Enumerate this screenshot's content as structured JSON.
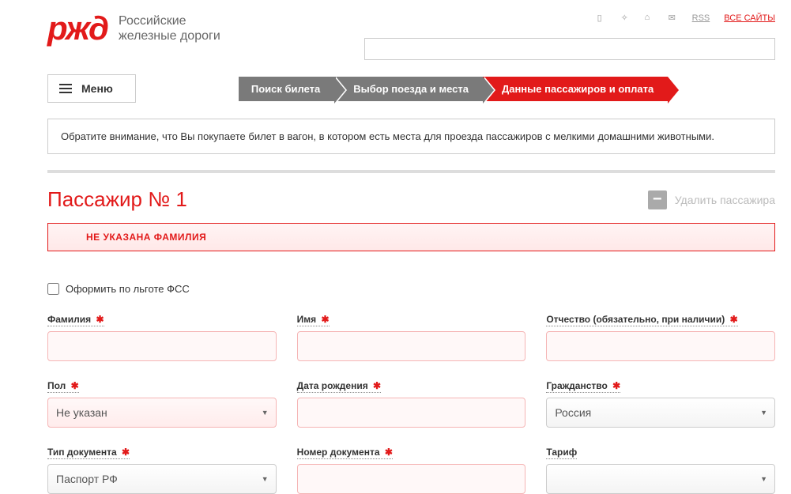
{
  "logo": {
    "text": "ржд",
    "subtitle_line1": "Российские",
    "subtitle_line2": "железные дороги"
  },
  "top_links": {
    "rss": "RSS",
    "all_sites": "ВСЕ САЙТЫ"
  },
  "menu_label": "Меню",
  "breadcrumb": {
    "step1": "Поиск билета",
    "step2": "Выбор поезда и места",
    "step3": "Данные пассажиров и оплата"
  },
  "notice_text": "Обратите внимание, что Вы покупаете билет в вагон, в котором есть места для проезда пассажиров с мелкими домашними животными.",
  "passenger": {
    "title": "Пассажир № 1",
    "delete_label": "Удалить пассажира",
    "error": "НЕ УКАЗАНА ФАМИЛИЯ",
    "fss_checkbox": "Оформить по льготе ФСС",
    "fields": {
      "surname": {
        "label": "Фамилия",
        "value": ""
      },
      "name": {
        "label": "Имя",
        "value": ""
      },
      "patronymic": {
        "label": "Отчество (обязательно, при наличии)",
        "value": ""
      },
      "gender": {
        "label": "Пол",
        "value": "Не указан"
      },
      "birthdate": {
        "label": "Дата рождения",
        "value": ""
      },
      "citizenship": {
        "label": "Гражданство",
        "value": "Россия"
      },
      "doc_type": {
        "label": "Тип документа",
        "value": "Паспорт РФ"
      },
      "doc_number": {
        "label": "Номер документа",
        "value": ""
      },
      "tariff": {
        "label": "Тариф",
        "value": ""
      }
    }
  }
}
